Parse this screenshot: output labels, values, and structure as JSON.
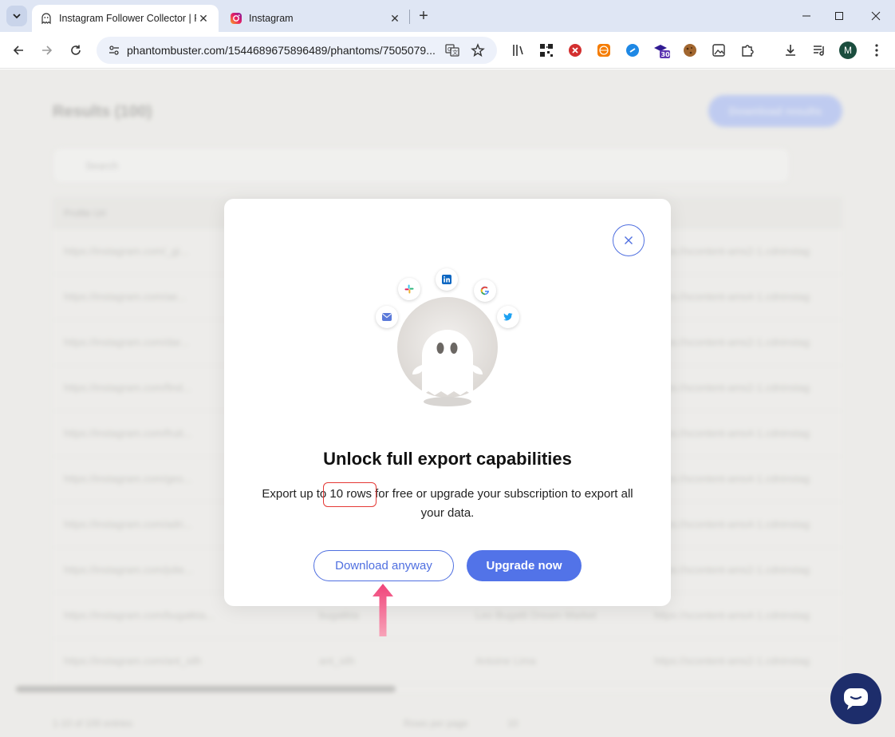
{
  "browser": {
    "tabs": [
      {
        "title": "Instagram Follower Collector | P",
        "active": true,
        "icon": "phantom-ghost-icon"
      },
      {
        "title": "Instagram",
        "active": false,
        "icon": "instagram-icon"
      }
    ],
    "url": "phantombuster.com/1544689675896489/phantoms/7505079...",
    "avatar_letter": "M",
    "extension_badge": "30"
  },
  "background_page": {
    "title": "Results (100)",
    "download_button": "Download results",
    "search_placeholder": "Search",
    "column_header_1": "Profile Url",
    "rows": [
      {
        "url": "https://instagram.com/_gi...",
        "col4": "https://scontent-ams2-1.cdninstag"
      },
      {
        "url": "https://instagram.com/ae...",
        "col4": "https://scontent-ams4-1.cdninstag"
      },
      {
        "url": "https://instagram.com/dar...",
        "col4": "https://scontent-ams2-1.cdninstag"
      },
      {
        "url": "https://instagram.com/find...",
        "col4": "https://scontent-ams2-1.cdninstag"
      },
      {
        "url": "https://instagram.com/fruit...",
        "col4": "https://scontent-ams4-1.cdninstag"
      },
      {
        "url": "https://instagram.com/geo...",
        "col4": "https://scontent-ams4-1.cdninstag"
      },
      {
        "url": "https://instagram.com/adri...",
        "col4": "https://scontent-ams4-1.cdninstag"
      },
      {
        "url": "https://instagram.com/jolie...",
        "col4": "https://scontent-ams2-1.cdninstag"
      },
      {
        "url": "https://instagram.com/bugatkta...",
        "col2": "bugatkta",
        "col3": "Leo Bugatti Dream Market",
        "col4": "https://scontent-ams4-1.cdninstag"
      },
      {
        "url": "https://instagram.com/ant_silh",
        "col2": "ant_silh",
        "col3": "Antoine Lima",
        "col4": "https://scontent-ams2-1.cdninstag"
      }
    ],
    "footer": "1-10 of 100 entries",
    "rows_per_page_label": "Rows per page",
    "rows_per_page_value": "10"
  },
  "modal": {
    "title": "Unlock full export capabilities",
    "desc_before": "Export up to ",
    "desc_highlight": "10 rows",
    "desc_after": " for free or upgrade your subscription to export all your data.",
    "download_anyway": "Download anyway",
    "upgrade_now": "Upgrade now",
    "integration_icons": [
      "email-icon",
      "slack-icon",
      "linkedin-icon",
      "google-icon",
      "twitter-icon"
    ]
  },
  "colors": {
    "accent": "#5273e8",
    "highlight_box": "#e53935",
    "arrow": "#f06292",
    "chat_button": "#1d2d6b"
  }
}
